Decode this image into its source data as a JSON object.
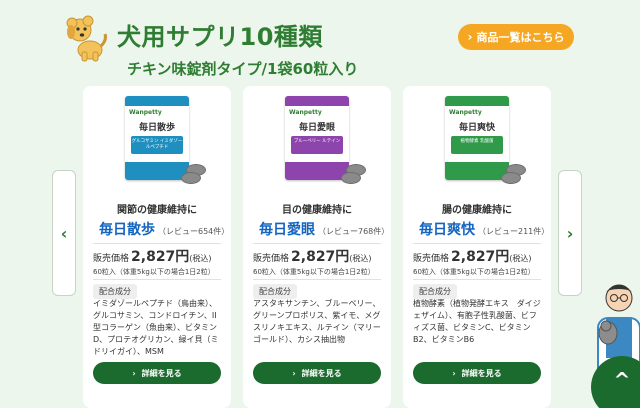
{
  "header": {
    "title": "犬用サプリ10種類",
    "subtitle": "チキン味錠剤タイプ/1袋60粒入り",
    "list_button_label": "商品一覧はこちら"
  },
  "colors": {
    "accent_green": "#2e7d32",
    "button_green": "#1b6b2f",
    "orange": "#f5a623",
    "product_blue": "#1565c0",
    "background": "#edf6ec"
  },
  "carousel": {
    "prev_icon": "chevron-left-icon",
    "next_icon": "chevron-right-icon"
  },
  "products": [
    {
      "pkg_brand": "Wanpetty",
      "pkg_name": "毎日散歩",
      "pkg_band": "グルコサミン イミダゾールペプチド",
      "pkg_color": "#1f8fbf",
      "catch": "関節の健康維持に",
      "name": "毎日散歩",
      "reviews": "（レビュー654件）",
      "price_label": "販売価格",
      "price": "2,827円",
      "tax": "(税込)",
      "qty": "60粒入（体重5kg以下の場合1日2粒）",
      "ing_label": "配合成分",
      "ingredients": "イミダゾールペプチド（鳥由来）、グルコサミン、コンドロイチン、II型コラーゲン（魚由来）、ビタミンD、プロテオグリカン、緑イ貝（ミドリイガイ）、MSM",
      "detail_label": "詳細を見る"
    },
    {
      "pkg_brand": "Wanpetty",
      "pkg_name": "毎日愛眼",
      "pkg_band": "ブルーベリー ルテイン",
      "pkg_color": "#8e44ad",
      "catch": "目の健康維持に",
      "name": "毎日愛眼",
      "reviews": "（レビュー768件）",
      "price_label": "販売価格",
      "price": "2,827円",
      "tax": "(税込)",
      "qty": "60粒入（体重5kg以下の場合1日2粒）",
      "ing_label": "配合成分",
      "ingredients": "アスタキサンチン、ブルーベリー、グリーンプロポリス、紫イモ、メグスリノキエキス、ルテイン（マリーゴールド）、カシス抽出物",
      "detail_label": "詳細を見る"
    },
    {
      "pkg_brand": "Wanpetty",
      "pkg_name": "毎日爽快",
      "pkg_band": "植物酵素 乳酸菌",
      "pkg_color": "#2e9a4a",
      "catch": "腸の健康維持に",
      "name": "毎日爽快",
      "reviews": "（レビュー211件）",
      "price_label": "販売価格",
      "price": "2,827円",
      "tax": "(税込)",
      "qty": "60粒入（体重5kg以下の場合1日2粒）",
      "ing_label": "配合成分",
      "ingredients": "植物酵素（植物発酵エキス　ダイジェザイム）、有胞子性乳酸菌、ビフィズス菌、ビタミンC、ビタミンB2、ビタミンB6",
      "detail_label": "詳細を見る"
    }
  ],
  "fab_icon": "chevron-up-icon"
}
